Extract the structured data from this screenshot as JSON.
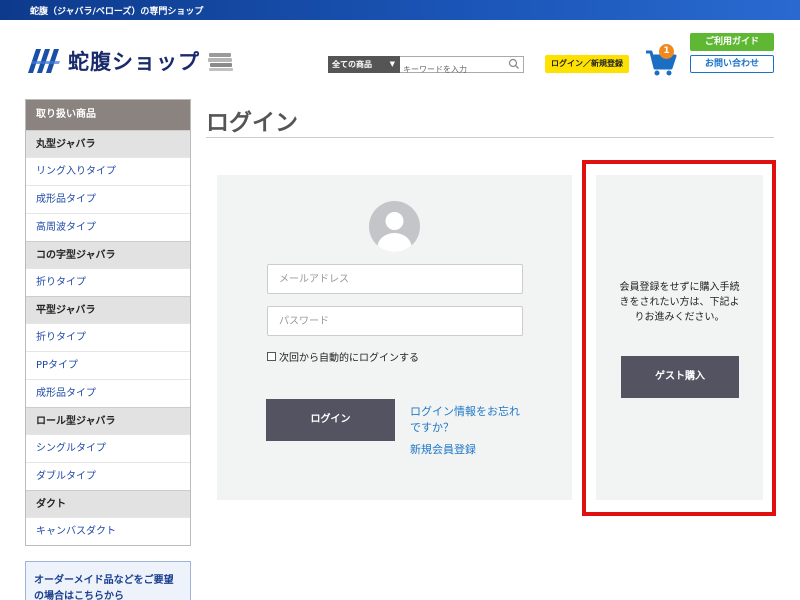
{
  "topbar": {
    "text": "蛇腹（ジャバラ/ベローズ）の専門ショップ"
  },
  "header": {
    "logo_text": "蛇腹ショップ",
    "search_category": "全ての商品",
    "search_placeholder": "キーワードを入力",
    "login_register": "ログイン／新規登録",
    "cart_count": "1",
    "guide_button": "ご利用ガイド",
    "contact_button": "お問い合わせ"
  },
  "sidebar": {
    "heading": "取り扱い商品",
    "categories": [
      {
        "label": "丸型ジャバラ",
        "items": [
          "リング入りタイプ",
          "成形品タイプ",
          "高周波タイプ"
        ]
      },
      {
        "label": "コの字型ジャバラ",
        "items": [
          "折りタイプ"
        ]
      },
      {
        "label": "平型ジャバラ",
        "items": [
          "折りタイプ",
          "PPタイプ",
          "成形品タイプ"
        ]
      },
      {
        "label": "ロール型ジャバラ",
        "items": [
          "シングルタイプ",
          "ダブルタイプ"
        ]
      },
      {
        "label": "ダクト",
        "items": [
          "キャンバスダクト"
        ]
      }
    ],
    "order_box": {
      "line1": "オーダーメイド品などをご要望",
      "line2": "の場合はこちらから"
    }
  },
  "main": {
    "title": "ログイン",
    "login": {
      "email_placeholder": "メールアドレス",
      "password_placeholder": "パスワード",
      "remember_label": "次回から自動的にログインする",
      "submit_label": "ログイン",
      "forgot_link": "ログイン情報をお忘れですか？",
      "register_link": "新規会員登録"
    },
    "guest": {
      "text": "会員登録をせずに購入手続きをされたい方は、下記よりお進みください。",
      "button_label": "ゲスト購入"
    }
  },
  "colors": {
    "brand_blue": "#1a2b6b",
    "button_dark": "#545361",
    "highlight_red": "#e01010",
    "badge_yellow": "#ffe100",
    "guide_green": "#5fb834"
  }
}
